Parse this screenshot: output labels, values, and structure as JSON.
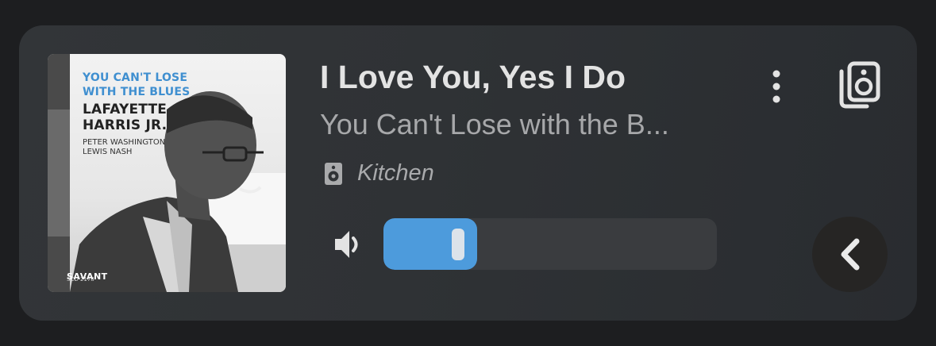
{
  "album": {
    "line1": "YOU CAN'T LOSE",
    "line2": "WITH THE BLUES",
    "artist_line1": "LAFAYETTE",
    "artist_line2": "HARRIS JR.",
    "musician1": "PETER WASHINGTON",
    "musician2": "LEWIS NASH",
    "label": "SAVANT"
  },
  "track": {
    "title": "I Love You, Yes I Do",
    "album_title": "You Can't Lose with the B..."
  },
  "zone": {
    "name": "Kitchen",
    "icon": "speaker-icon"
  },
  "volume": {
    "level": 0.28,
    "icon": "volume-icon"
  },
  "controls": {
    "more_icon": "more-vertical-icon",
    "group_icon": "speaker-group-icon",
    "back_icon": "chevron-left-icon"
  },
  "colors": {
    "accent": "#4d9bdc",
    "card": "#323538",
    "background": "#1d1e20"
  }
}
